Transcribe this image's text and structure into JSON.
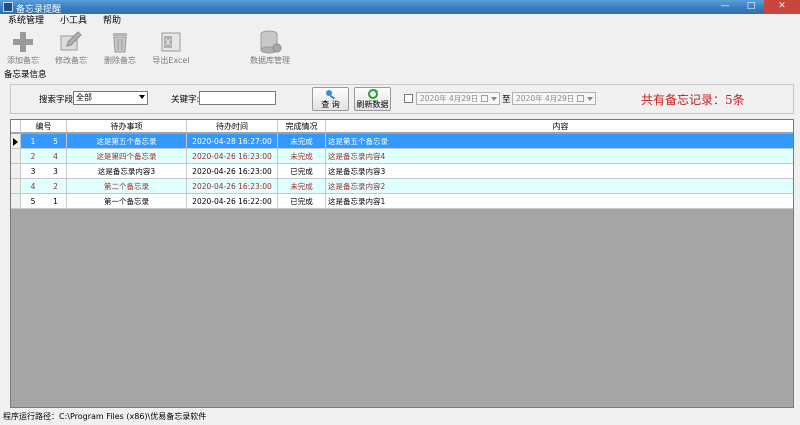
{
  "window": {
    "title": "备忘录提醒",
    "minimize": "—",
    "maximize": "□",
    "close": "✕"
  },
  "menu": [
    "系统管理",
    "小工具",
    "帮助"
  ],
  "toolbar": [
    {
      "label": "添加备忘",
      "icon": "plus-icon"
    },
    {
      "label": "修改备忘",
      "icon": "edit-icon"
    },
    {
      "label": "删除备忘",
      "icon": "trash-icon"
    },
    {
      "label": "导出Excel",
      "icon": "excel-icon"
    },
    {
      "label": "数据库管理",
      "icon": "database-icon"
    }
  ],
  "section_label": "备忘录信息",
  "search": {
    "field_label": "搜索字段:",
    "field_value": "全部",
    "keyword_label": "关键字:",
    "keyword_value": "",
    "query_button": "查 询",
    "refresh_button": "刷新数据",
    "date_from": "2020年  4月29日",
    "to_label": "至",
    "date_to": "2020年  4月29日",
    "total": "共有备忘记录：5条"
  },
  "table": {
    "columns": [
      "编号",
      "待办事项",
      "待办时间",
      "完成情况",
      "内容"
    ],
    "rows": [
      {
        "index": "1",
        "id": "5",
        "item": "这是第五个备忘录",
        "time": "2020-04-28 16:27:00",
        "status": "未完成",
        "content": "这是第五个备忘录",
        "style": "selected"
      },
      {
        "index": "2",
        "id": "4",
        "item": "这是第四个备忘录",
        "time": "2020-04-26 16:23:00",
        "status": "未完成",
        "content": "这是备忘录内容4",
        "style": "alt-red"
      },
      {
        "index": "3",
        "id": "3",
        "item": "这是备忘录内容3",
        "time": "2020-04-26 16:23:00",
        "status": "已完成",
        "content": "这是备忘录内容3",
        "style": "normal"
      },
      {
        "index": "4",
        "id": "2",
        "item": "第二个备忘录",
        "time": "2020-04-26 16:23:00",
        "status": "未完成",
        "content": "这是备忘录内容2",
        "style": "alt-red"
      },
      {
        "index": "5",
        "id": "1",
        "item": "第一个备忘录",
        "time": "2020-04-26 16:22:00",
        "status": "已完成",
        "content": "这是备忘录内容1",
        "style": "normal"
      }
    ]
  },
  "status_bar": "程序运行路径：C:\\Program Files (x86)\\优易备忘录软件",
  "colors": {
    "selected_bg": "#3399ff",
    "alt_bg": "#e0ffff",
    "alt_text": "#a52a2a",
    "total_red": "#c81e1e"
  }
}
